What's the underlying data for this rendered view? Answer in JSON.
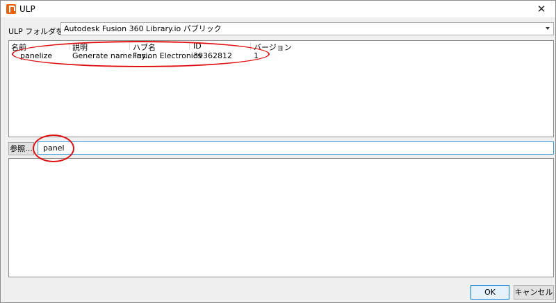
{
  "window": {
    "title": "ULP",
    "close_glyph": "✕"
  },
  "folder": {
    "label": "ULP フォルダを選択:",
    "selected": "Autodesk Fusion 360 Library.io パブリック"
  },
  "table": {
    "columns": [
      "名前",
      "説明",
      "ハブ名",
      "ID",
      "バージョン"
    ],
    "rows": [
      {
        "name": "panelize",
        "description": "Generate name lay...",
        "hub": "Fusion Electronics",
        "id": "39362812",
        "version": "1"
      }
    ]
  },
  "browse": {
    "label": "参照..."
  },
  "filter": {
    "value": "panel"
  },
  "buttons": {
    "ok": "OK",
    "cancel": "キャンセル"
  },
  "colors": {
    "annotation": "#e01010",
    "focus_border": "#3c9ad6",
    "app_icon": "#e8620e"
  }
}
